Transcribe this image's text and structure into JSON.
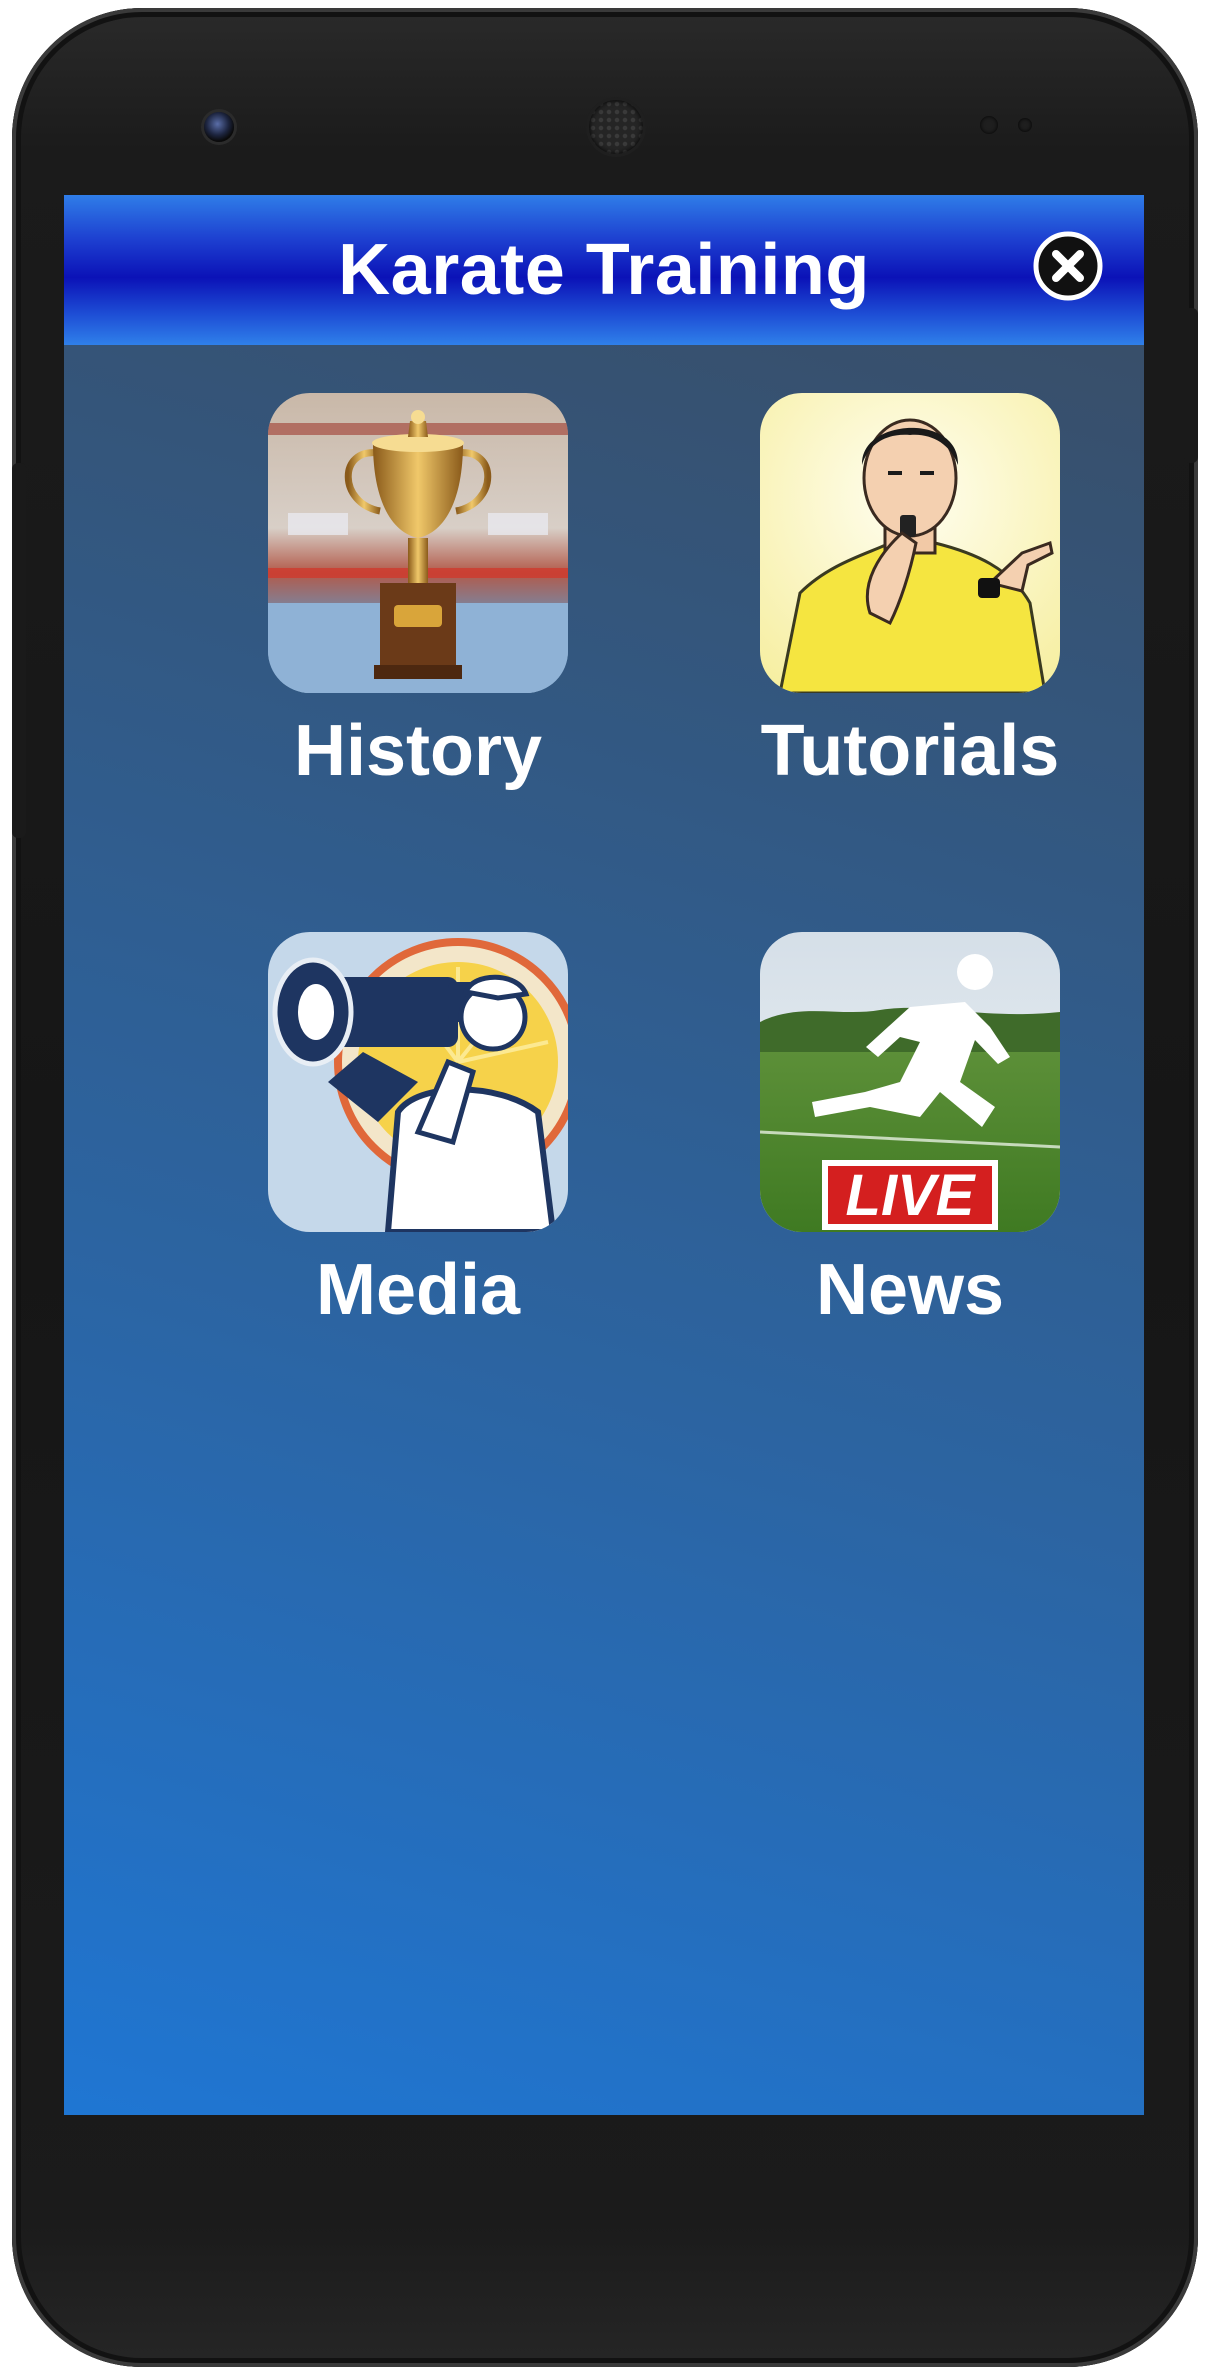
{
  "app": {
    "title": "Karate Training"
  },
  "menu": {
    "items": [
      {
        "label": "History",
        "icon": "trophy-icon"
      },
      {
        "label": "Tutorials",
        "icon": "referee-whistle-icon"
      },
      {
        "label": "Media",
        "icon": "cameraman-icon"
      },
      {
        "label": "News",
        "icon": "live-runner-icon",
        "badge": "LIVE"
      }
    ]
  },
  "colors": {
    "titlebar_dark": "#0b12b7",
    "titlebar_light": "#2f80ea",
    "background_top": "#3a4c63",
    "background_bottom": "#1f76d3",
    "text": "#ffffff",
    "live_badge": "#d41f1f"
  },
  "icons": {
    "close": "close-circle-icon"
  }
}
